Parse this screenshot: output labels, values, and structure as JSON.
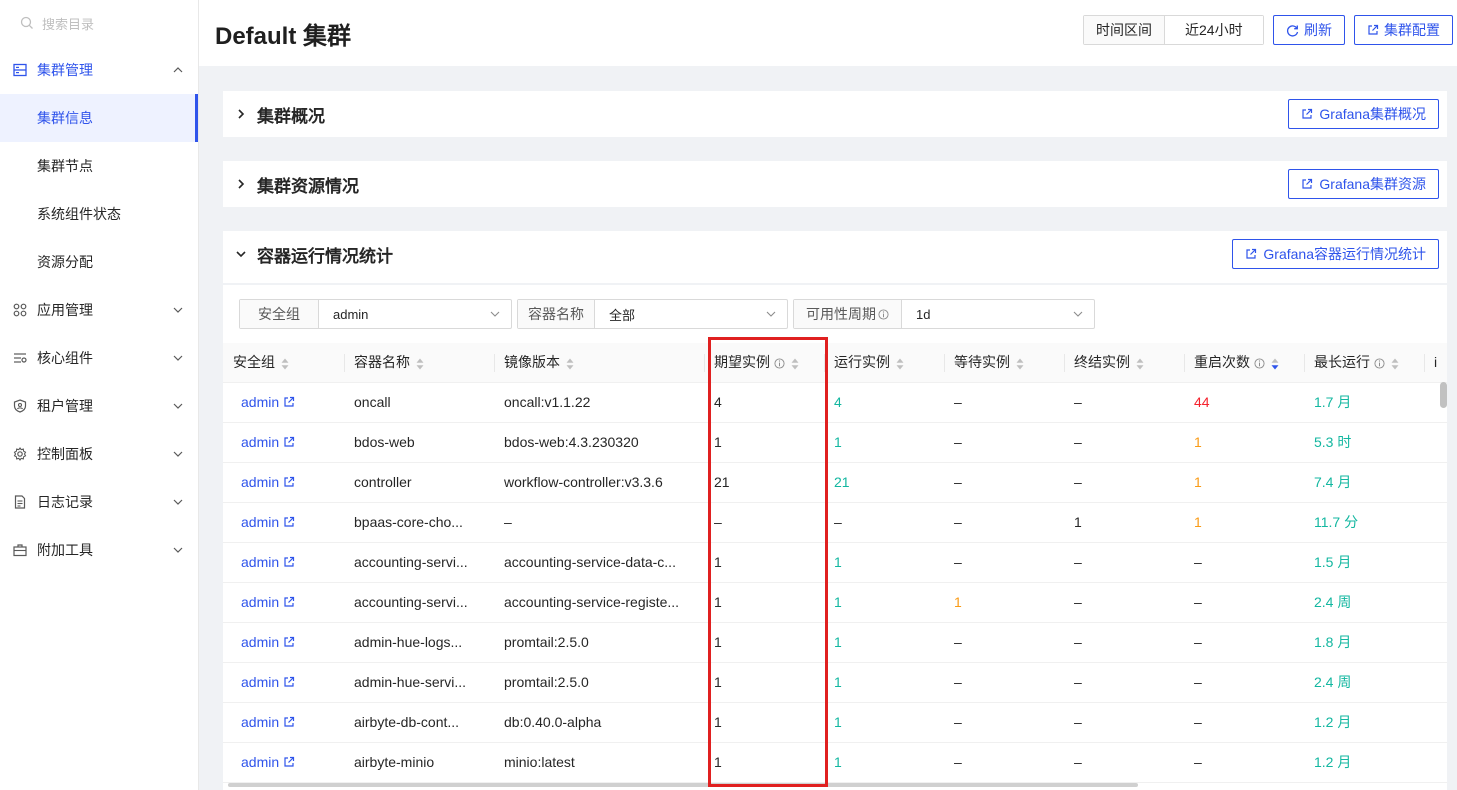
{
  "sidebar": {
    "search_placeholder": "搜索目录",
    "groups": [
      {
        "label": "集群管理",
        "icon": "server-icon",
        "expanded": true,
        "items": [
          "集群信息",
          "集群节点",
          "系统组件状态",
          "资源分配"
        ],
        "selected": "集群信息"
      },
      {
        "label": "应用管理",
        "icon": "apps-icon"
      },
      {
        "label": "核心组件",
        "icon": "components-icon"
      },
      {
        "label": "租户管理",
        "icon": "tenant-shield-icon"
      },
      {
        "label": "控制面板",
        "icon": "gear-icon"
      },
      {
        "label": "日志记录",
        "icon": "log-icon"
      },
      {
        "label": "附加工具",
        "icon": "toolbox-icon"
      }
    ]
  },
  "header": {
    "title": "Default 集群",
    "time_label": "时间区间",
    "time_value": "近24小时",
    "refresh_label": "刷新",
    "config_label": "集群配置"
  },
  "panels": {
    "overview": {
      "title": "集群概况",
      "button": "Grafana集群概况"
    },
    "resources": {
      "title": "集群资源情况",
      "button": "Grafana集群资源"
    },
    "containers": {
      "title": "容器运行情况统计",
      "button": "Grafana容器运行情况统计"
    }
  },
  "filters": {
    "group_label": "安全组",
    "group_value": "admin",
    "name_label": "容器名称",
    "name_value": "全部",
    "period_label": "可用性周期",
    "period_value": "1d"
  },
  "table": {
    "headers": [
      "安全组",
      "容器名称",
      "镜像版本",
      "期望实例",
      "运行实例",
      "等待实例",
      "终结实例",
      "重启次数",
      "最长运行",
      "i"
    ],
    "rows": [
      [
        "admin",
        "oncall",
        "oncall:v1.1.22",
        "4",
        "4",
        "–",
        "–",
        "44",
        "1.7 月"
      ],
      [
        "admin",
        "bdos-web",
        "bdos-web:4.3.230320",
        "1",
        "1",
        "–",
        "–",
        "1",
        "5.3 时"
      ],
      [
        "admin",
        "controller",
        "workflow-controller:v3.3.6",
        "21",
        "21",
        "–",
        "–",
        "1",
        "7.4 月"
      ],
      [
        "admin",
        "bpaas-core-cho...",
        "–",
        "–",
        "–",
        "–",
        "1",
        "1",
        "11.7 分"
      ],
      [
        "admin",
        "accounting-servi...",
        "accounting-service-data-c...",
        "1",
        "1",
        "–",
        "–",
        "–",
        "1.5 月"
      ],
      [
        "admin",
        "accounting-servi...",
        "accounting-service-registe...",
        "1",
        "1",
        "1",
        "–",
        "–",
        "2.4 周"
      ],
      [
        "admin",
        "admin-hue-logs...",
        "promtail:2.5.0",
        "1",
        "1",
        "–",
        "–",
        "–",
        "1.8 月"
      ],
      [
        "admin",
        "admin-hue-servi...",
        "promtail:2.5.0",
        "1",
        "1",
        "–",
        "–",
        "–",
        "2.4 周"
      ],
      [
        "admin",
        "airbyte-db-cont...",
        "db:0.40.0-alpha",
        "1",
        "1",
        "–",
        "–",
        "–",
        "1.2 月"
      ],
      [
        "admin",
        "airbyte-minio",
        "minio:latest",
        "1",
        "1",
        "–",
        "–",
        "–",
        "1.2 月"
      ]
    ]
  },
  "colors": {
    "accent": "#2f54eb",
    "green": "#13b7a0",
    "red": "#f5222d",
    "orange": "#fa9b16",
    "highlight": "#e02020"
  }
}
